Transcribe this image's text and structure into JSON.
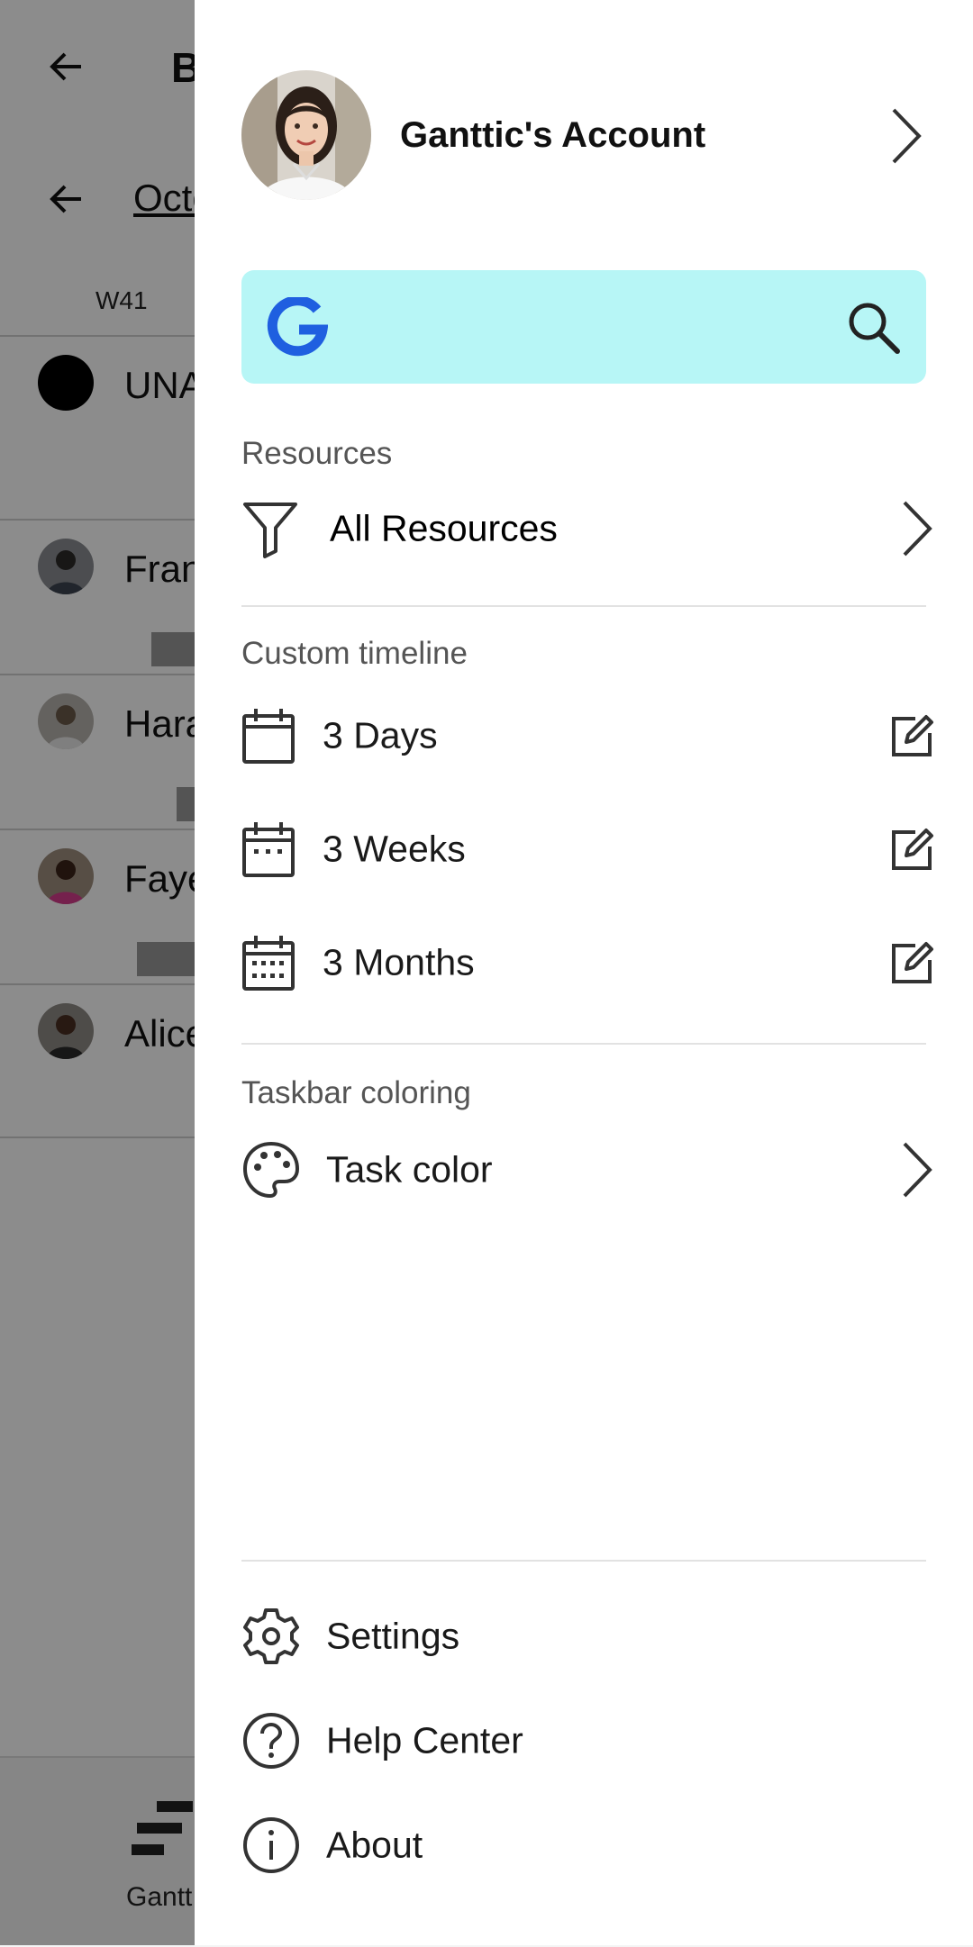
{
  "background": {
    "title_fragment": "B",
    "month_fragment": "Octo",
    "week_label": "W41",
    "rows": [
      {
        "name": "UNA"
      },
      {
        "name": "Fran"
      },
      {
        "name": "Hara"
      },
      {
        "name": "Faye"
      },
      {
        "name": "Alice"
      }
    ],
    "bottom_nav_label": "Gantt"
  },
  "drawer": {
    "account": {
      "name": "Ganttic's Account"
    },
    "search": {
      "placeholder": ""
    },
    "sections": {
      "resources": {
        "label": "Resources",
        "item": "All Resources"
      },
      "custom_timeline": {
        "label": "Custom timeline",
        "items": [
          "3 Days",
          "3 Weeks",
          "3 Months"
        ]
      },
      "taskbar_coloring": {
        "label": "Taskbar coloring",
        "item": "Task color"
      }
    },
    "footer": {
      "items": [
        "Settings",
        "Help Center",
        "About"
      ]
    }
  },
  "colors": {
    "search_bg": "#b7f6f6",
    "google_blue": "#1f5fe0",
    "scrim": "rgba(0,0,0,0.45)"
  }
}
